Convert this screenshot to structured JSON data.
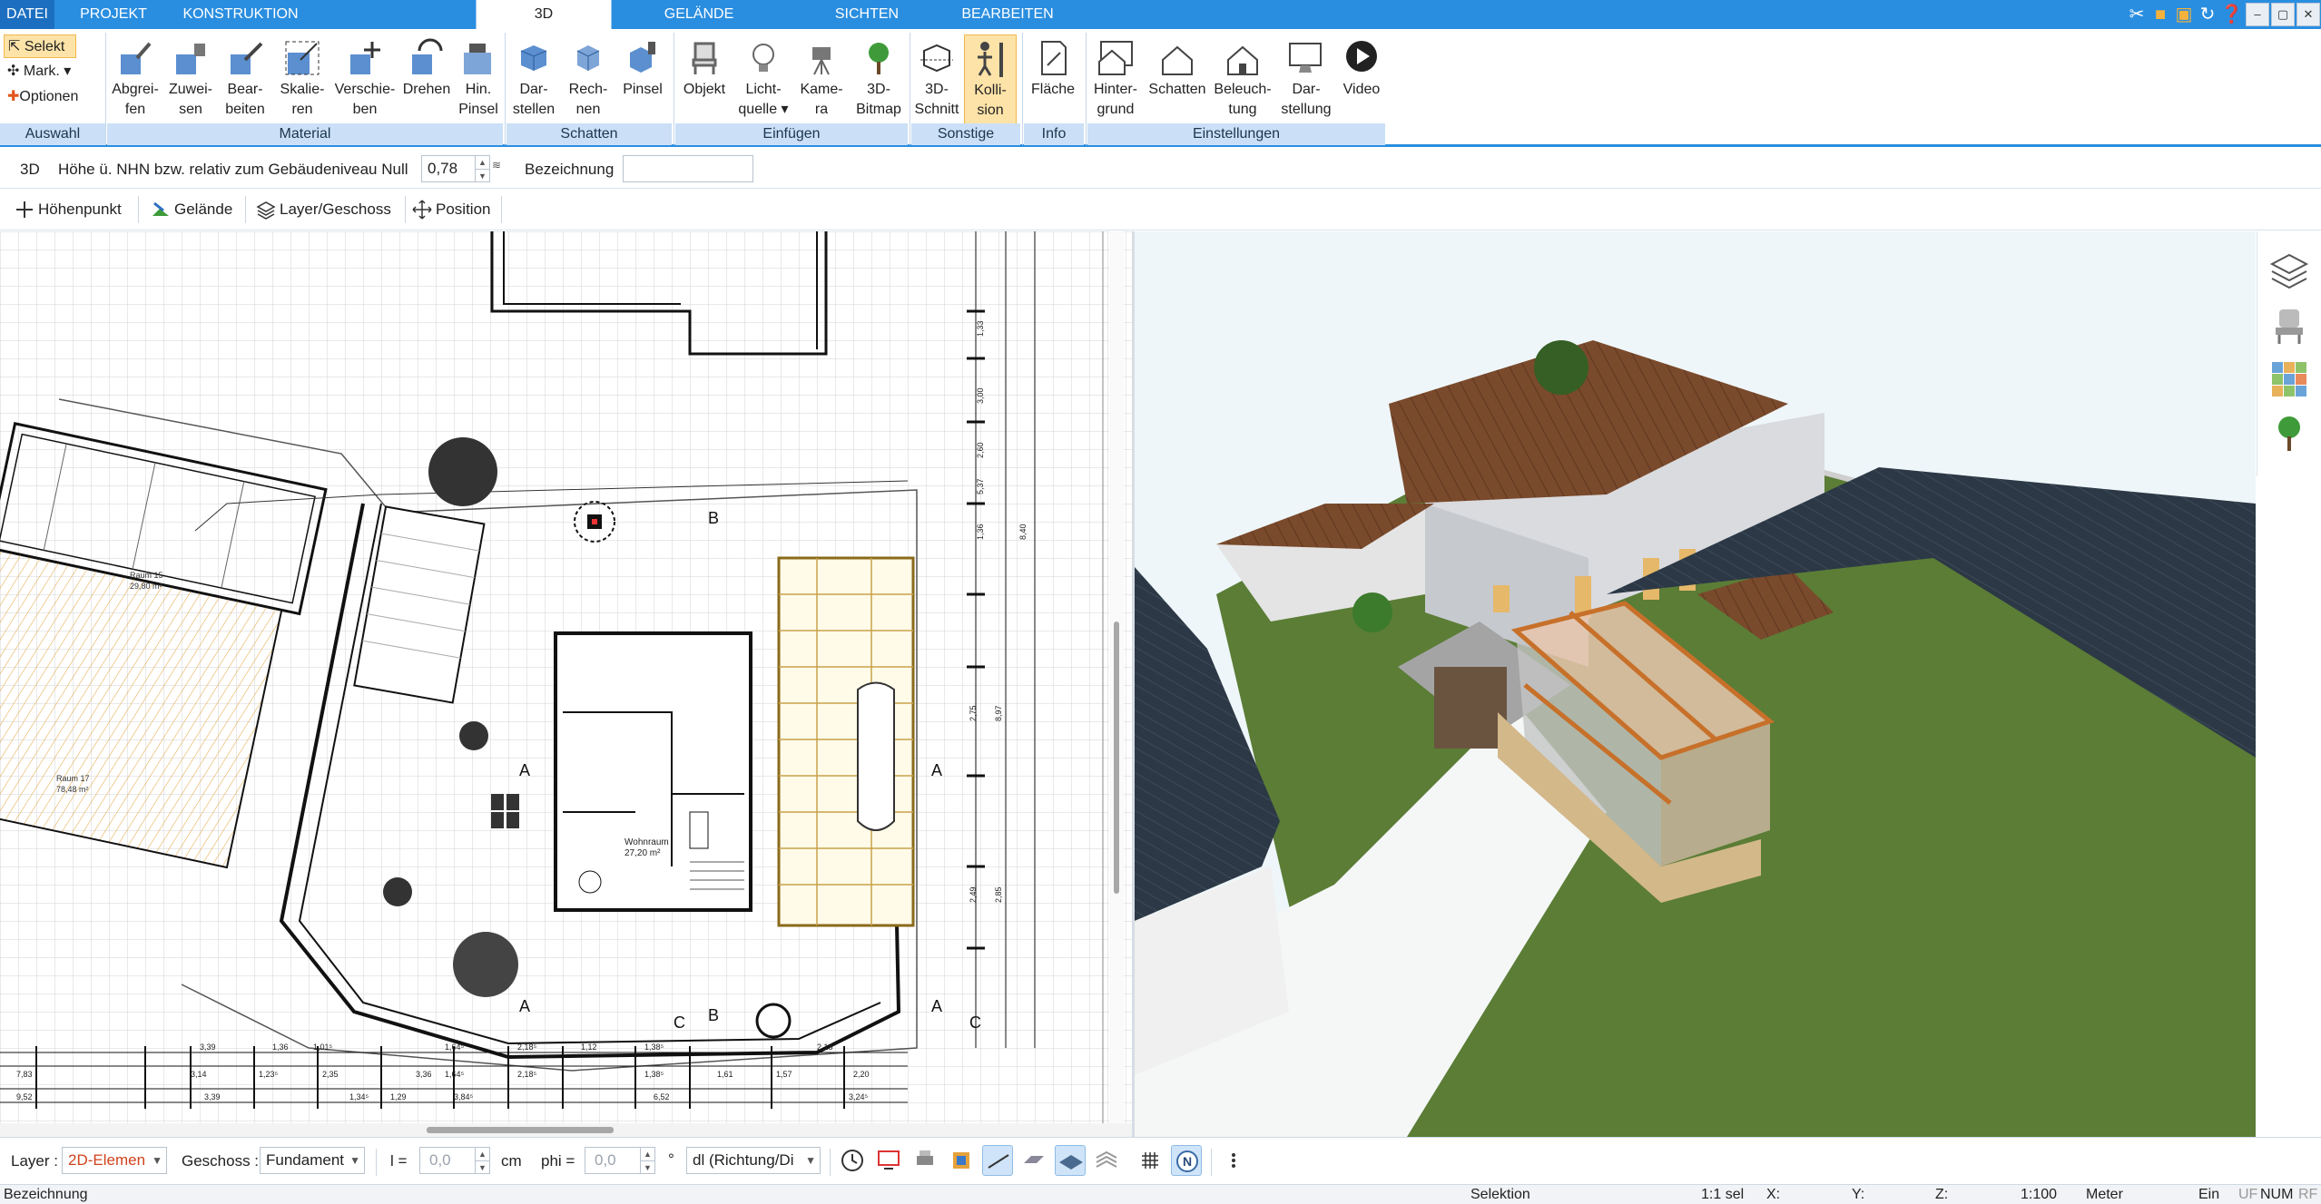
{
  "tabs": [
    "DATEI",
    "PROJEKT",
    "KONSTRUKTION",
    "3D",
    "GELÄNDE",
    "SICHTEN",
    "BEARBEITEN"
  ],
  "active_tab": "3D",
  "window_controls": [
    "–",
    "▢",
    "✕"
  ],
  "ribbon": {
    "auswahl": {
      "label": "Auswahl",
      "selekt": "Selekt",
      "mark": "Mark.",
      "optionen": "Optionen"
    },
    "material": {
      "label": "Material",
      "buttons": [
        [
          "Abgrei-",
          "fen"
        ],
        [
          "Zuwei-",
          "sen"
        ],
        [
          "Bear-",
          "beiten"
        ],
        [
          "Skalie-",
          "ren"
        ],
        [
          "Verschie-",
          "ben"
        ],
        [
          "Drehen",
          ""
        ],
        [
          "Hin.",
          "Pinsel"
        ]
      ]
    },
    "schatten": {
      "label": "Schatten",
      "buttons": [
        [
          "Dar-",
          "stellen"
        ],
        [
          "Rech-",
          "nen"
        ],
        [
          "Pinsel",
          ""
        ]
      ]
    },
    "einfuegen": {
      "label": "Einfügen",
      "buttons": [
        [
          "Objekt",
          ""
        ],
        [
          "Licht-",
          "quelle"
        ],
        [
          "Kame-",
          "ra"
        ],
        [
          "3D-",
          "Bitmap"
        ]
      ]
    },
    "sonstige": {
      "label": "Sonstige",
      "buttons": [
        [
          "3D-",
          "Schnitt"
        ],
        [
          "Kolli-",
          "sion"
        ]
      ]
    },
    "info": {
      "label": "Info",
      "buttons": [
        [
          "Fläche",
          ""
        ]
      ]
    },
    "einstellungen": {
      "label": "Einstellungen",
      "buttons": [
        [
          "Hinter-",
          "grund"
        ],
        [
          "Schatten",
          ""
        ],
        [
          "Beleuch-",
          "tung"
        ],
        [
          "Dar-",
          "stellung"
        ],
        [
          "Video",
          ""
        ]
      ]
    }
  },
  "toolbar2": {
    "mode": "3D",
    "hoehe_label": "Höhe ü. NHN bzw. relativ zum Gebäudeniveau Null",
    "hoehe_value": "0,78",
    "bezeichnung_label": "Bezeichnung",
    "bezeichnung_value": ""
  },
  "toolbar3": [
    "Höhenpunkt",
    "Gelände",
    "Layer/Geschoss",
    "Position"
  ],
  "plan_labels": {
    "raum15": "Raum 15",
    "raum15_area": "29,80 m²",
    "raum17": "Raum 17",
    "raum17_area": "78,48 m²",
    "wohnraum": "Wohnraum",
    "wohnraum_area": "27,20 m²",
    "section_a": "A",
    "section_b": "B",
    "section_c": "C",
    "dims_row1": [
      "7,83",
      "3,14",
      "1,23⁵",
      "2,35",
      "3,36",
      "1,64⁵",
      "2,18⁵",
      "1,38⁵",
      "1,61",
      "1,57",
      "2,20"
    ],
    "dims_row2": [
      "9,52",
      "3,39",
      "1,34⁵",
      "1,29",
      "3,84⁵",
      "6,52",
      "3,24⁵"
    ],
    "dims_top": [
      "3,39",
      "1,36",
      "1,01⁵",
      "1,64⁵",
      "2,18⁵",
      "1,12",
      "1,38⁵",
      "2,18"
    ],
    "dims_vert": [
      "1,33",
      "3,00",
      "2,60",
      "5,37",
      "8,40",
      "1,36",
      "2,75",
      "8,97",
      "2,49",
      "2,85"
    ]
  },
  "bottom": {
    "layer_label": "Layer :",
    "layer_value": "2D-Elemen",
    "geschoss_label": "Geschoss :",
    "geschoss_value": "Fundament",
    "l_label": "l =",
    "l_value": "0,0",
    "l_unit": "cm",
    "phi_label": "phi =",
    "phi_value": "0,0",
    "phi_unit": "°",
    "dl_value": "dl (Richtung/Di"
  },
  "status": {
    "bezeichnung": "Bezeichnung",
    "selektion": "Selektion",
    "sel": "1:1 sel",
    "x": "X:",
    "y": "Y:",
    "z": "Z:",
    "scale": "1:100",
    "unit": "Meter",
    "ein": "Ein",
    "uf": "UF",
    "num": "NUM",
    "rf": "RF"
  },
  "colors": {
    "accent": "#2a8ee0",
    "ribbon_label": "#cbe0f6",
    "roof": "#7a4a2c",
    "grass": "#5b7d36",
    "dark_roof": "#2c3845"
  }
}
